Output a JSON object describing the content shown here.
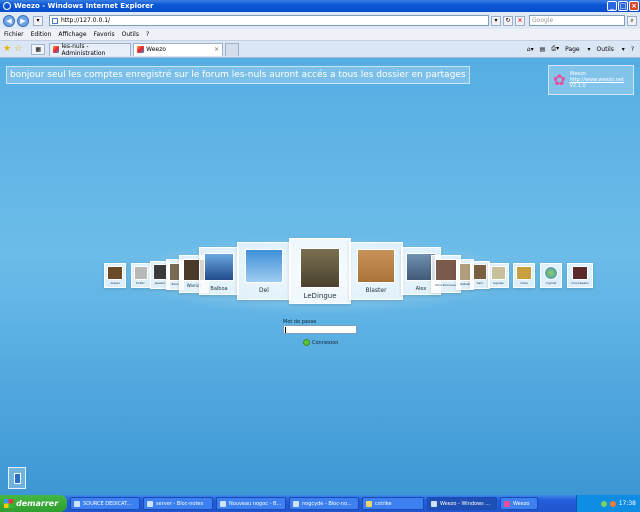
{
  "window": {
    "title": "Weezo - Windows Internet Explorer"
  },
  "address": {
    "url": "http://127.0.0.1/",
    "search_placeholder": "Google"
  },
  "menu": [
    "Fichier",
    "Edition",
    "Affichage",
    "Favoris",
    "Outils",
    "?"
  ],
  "tabs": [
    {
      "label": "les-nuls - Administration"
    },
    {
      "label": "Weezo"
    }
  ],
  "toolbar": {
    "page": "Page",
    "tools": "Outils"
  },
  "content": {
    "banner": "bonjour seul les comptes enregistré sur le forum les-nuls auront accés a tous les dossier en partages",
    "logo": {
      "name": "Weezo",
      "url": "http://www.weezo.net",
      "version": "V2.1.0"
    },
    "users": [
      {
        "name": "wissel",
        "color": "#6b4a2a"
      },
      {
        "name": "Public",
        "color": "#b8b8b8"
      },
      {
        "name": "Jessam",
        "color": "#3a3a3a"
      },
      {
        "name": "Zeus",
        "color": "#7a6a55"
      },
      {
        "name": "Warrior",
        "color": "#4a3a2a"
      },
      {
        "name": "Balboa",
        "color": "#224a8a"
      },
      {
        "name": "Del",
        "color": "#3f8fd8"
      },
      {
        "name": "LeDingue",
        "color": "#4a4230"
      },
      {
        "name": "Blaster",
        "color": "#a8743a"
      },
      {
        "name": "Alex",
        "color": "#405a78"
      },
      {
        "name": "Chucktonneau",
        "color": "#7a5a4a"
      },
      {
        "name": "KaKaZ",
        "color": "#b0a080"
      },
      {
        "name": "Sam",
        "color": "#7a6040"
      },
      {
        "name": "legolas",
        "color": "#c8c098"
      },
      {
        "name": "mike",
        "color": "#c8a040"
      },
      {
        "name": "mymet",
        "color": "#3a8ad0"
      },
      {
        "name": "moonbeans",
        "color": "#5a2a2a"
      }
    ],
    "login": {
      "label": "Mot de passe",
      "button": "Connexion"
    }
  },
  "taskbar": {
    "start": "demarrer",
    "tasks": [
      "SOURCE DEDICAT...",
      "server - Bloc-notes",
      "Nouveau nogoc - B...",
      "nogcyde - Bloc-no...",
      "cstrike",
      "Weezo - Windows ...",
      "Weezo"
    ],
    "clock": "17:38"
  }
}
